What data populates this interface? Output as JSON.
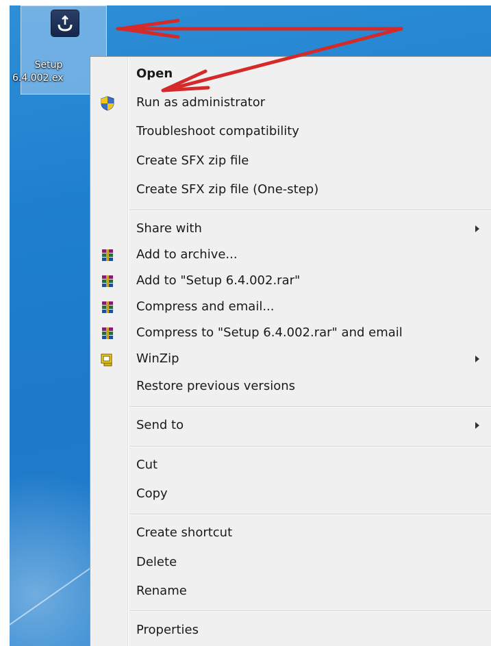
{
  "desktop": {
    "file_icon": {
      "icon": "setup-installer-icon",
      "label_line1": "Setup",
      "label_line2": "6.4.002.ex"
    }
  },
  "context_menu": {
    "items": [
      {
        "label": "Open",
        "bold": true
      },
      {
        "label": "Run as administrator",
        "icon": "uac-shield-icon"
      },
      {
        "label": "Troubleshoot compatibility"
      },
      {
        "label": "Create SFX zip file"
      },
      {
        "label": "Create SFX zip file (One-step)"
      },
      {
        "label": "Share with",
        "submenu": true
      },
      {
        "label": "Add to archive...",
        "icon": "winrar-icon"
      },
      {
        "label": "Add to \"Setup 6.4.002.rar\"",
        "icon": "winrar-icon"
      },
      {
        "label": "Compress and email...",
        "icon": "winrar-icon"
      },
      {
        "label": "Compress to \"Setup 6.4.002.rar\" and email",
        "icon": "winrar-icon"
      },
      {
        "label": "WinZip",
        "icon": "winzip-icon",
        "submenu": true
      },
      {
        "label": "Restore previous versions"
      },
      {
        "label": "Send to",
        "submenu": true
      },
      {
        "label": "Cut"
      },
      {
        "label": "Copy"
      },
      {
        "label": "Create shortcut"
      },
      {
        "label": "Delete"
      },
      {
        "label": "Rename"
      },
      {
        "label": "Properties"
      }
    ]
  },
  "annotation": {
    "arrow_color": "#d42a2a",
    "points_to": [
      "desktop-file-icon",
      "menu-item-run-as-administrator"
    ]
  },
  "colors": {
    "desktop_blue": "#1f7fcf",
    "menu_background": "#f0f0f0"
  }
}
